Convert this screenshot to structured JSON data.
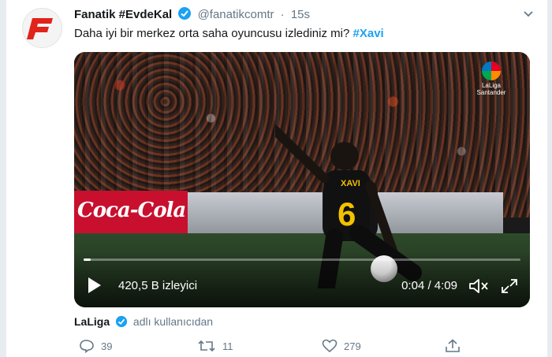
{
  "tweet": {
    "name": "Fanatik #EvdeKal",
    "handle": "@fanatikcomtr",
    "time": "15s",
    "dot": "·",
    "text": "Daha iyi bir merkez orta saha oyuncusu izlediniz mi?",
    "hashtag": "#Xavi"
  },
  "video": {
    "views": "420,5 B izleyici",
    "time": "0:04 / 4:09",
    "progress": 0.016,
    "logo_line1": "LaLiga",
    "logo_line2": "Santander",
    "board_text": "Coca-Cola",
    "jersey_name": "XAVI",
    "jersey_number": "6"
  },
  "source": {
    "name": "LaLiga",
    "suffix": "adlı kullanıcıdan"
  },
  "actions": {
    "replies": "39",
    "retweets": "11",
    "likes": "279"
  },
  "colors": {
    "accent": "#1da1f2",
    "logo_red": "#e2231a"
  }
}
